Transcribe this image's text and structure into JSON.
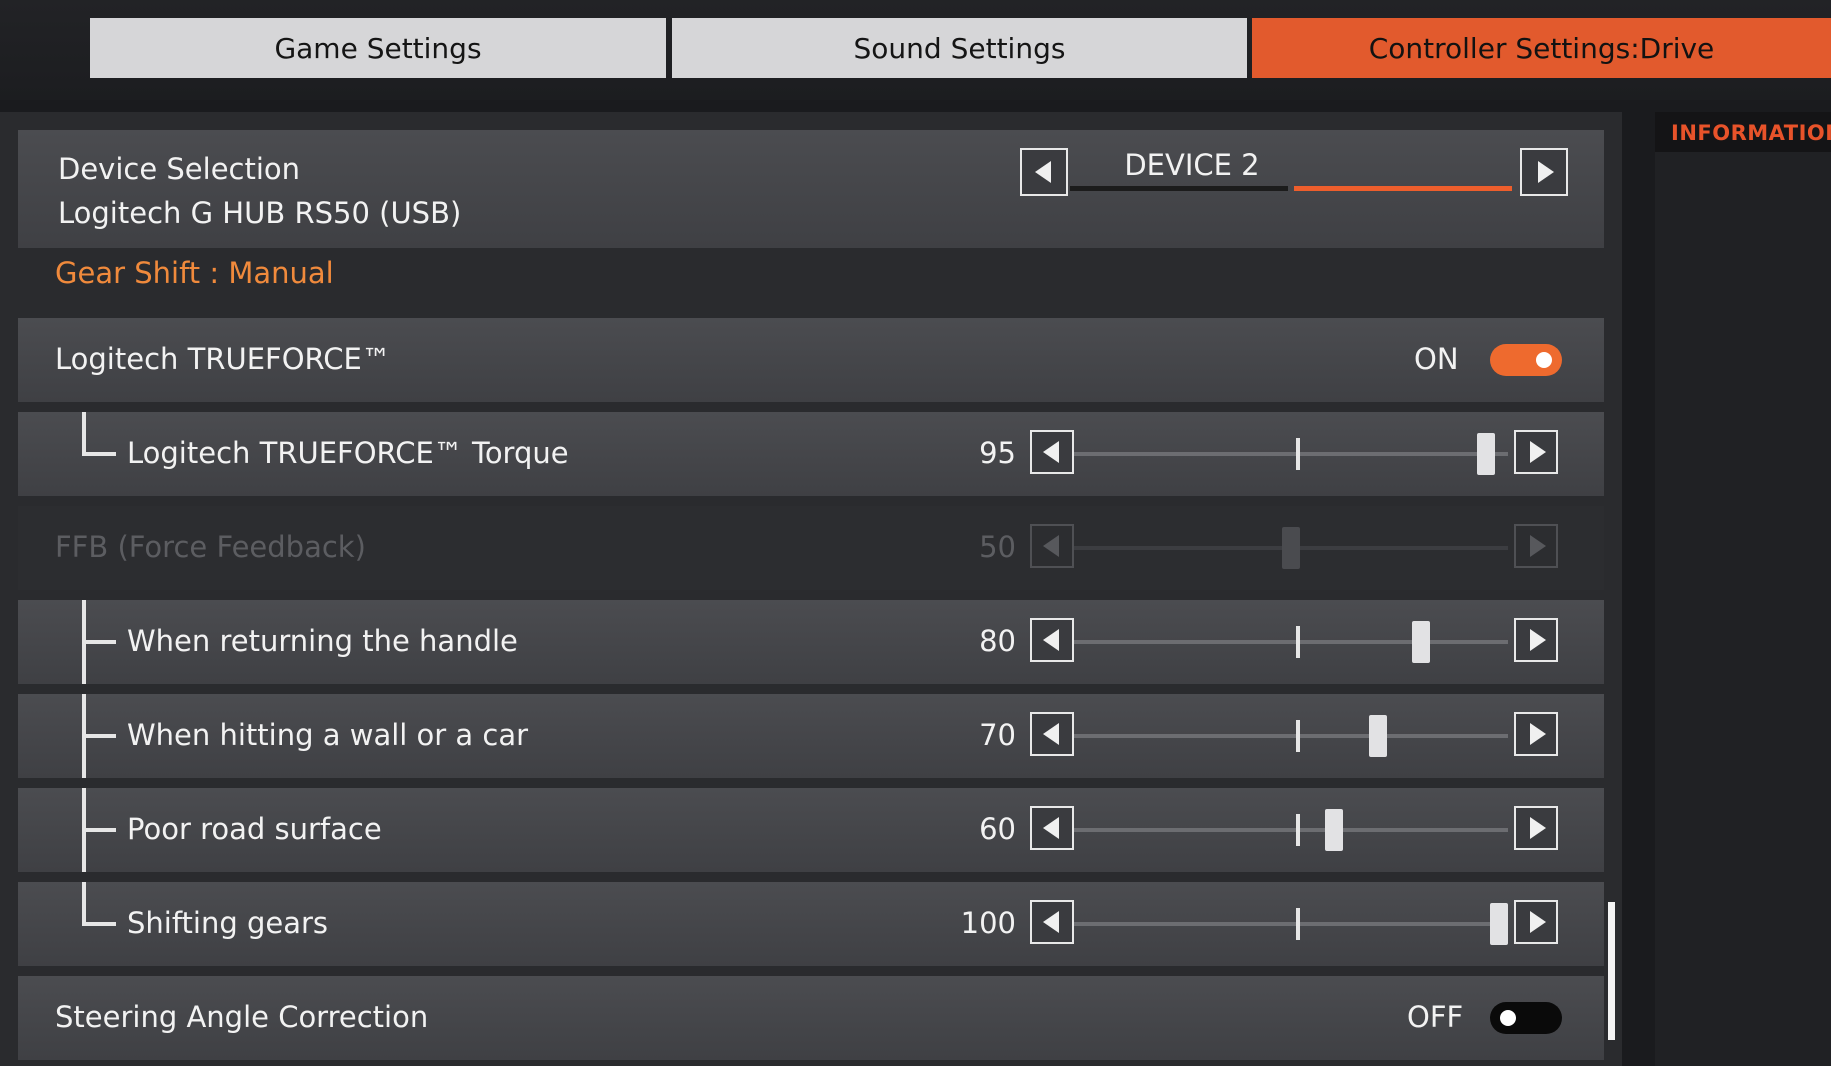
{
  "tabs": [
    {
      "label": "Game Settings",
      "active": false
    },
    {
      "label": "Sound Settings",
      "active": false
    },
    {
      "label": "Controller Settings:Drive",
      "active": true
    }
  ],
  "device": {
    "title": "Device Selection",
    "name": "Logitech G HUB RS50 (USB)",
    "selected": "DEVICE 2",
    "selected_index": 2,
    "count": 2
  },
  "gear_shift": "Gear Shift : Manual",
  "trueforce": {
    "label": "Logitech TRUEFORCE™",
    "state": "ON"
  },
  "sliders": [
    {
      "label": "Logitech TRUEFORCE™ Torque",
      "value": "95",
      "percent": 95,
      "disabled": false
    },
    {
      "label": "FFB (Force Feedback)",
      "value": "50",
      "percent": 50,
      "disabled": true
    },
    {
      "label": "When returning the handle",
      "value": "80",
      "percent": 80,
      "disabled": false
    },
    {
      "label": "When hitting a wall or a car",
      "value": "70",
      "percent": 70,
      "disabled": false
    },
    {
      "label": "Poor road surface",
      "value": "60",
      "percent": 60,
      "disabled": false
    },
    {
      "label": "Shifting gears",
      "value": "100",
      "percent": 100,
      "disabled": false
    }
  ],
  "steering": {
    "label": "Steering Angle Correction",
    "state": "OFF"
  },
  "info_header": "INFORMATION",
  "colors": {
    "accent": "#e25a2d",
    "toggle_on": "#ee6a2e",
    "gear_text": "#f08a3c"
  }
}
